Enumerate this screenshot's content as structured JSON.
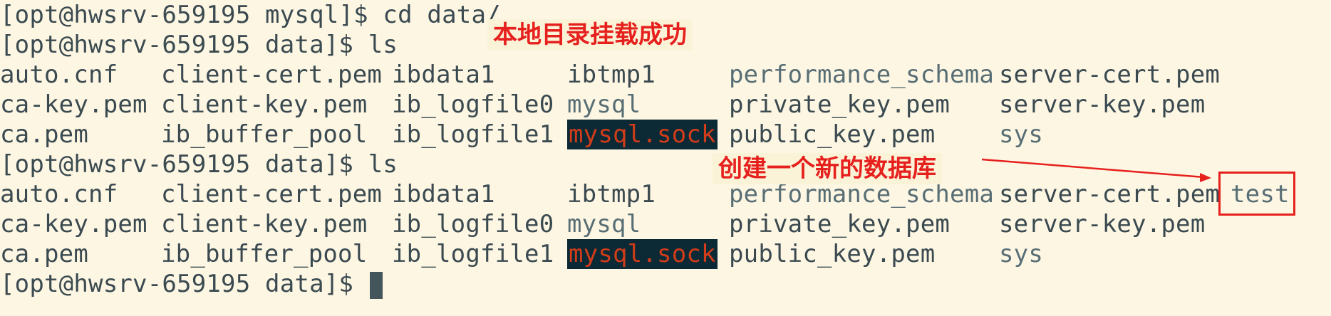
{
  "terminal": {
    "lines": [
      {
        "type": "prompt",
        "prompt": "[opt@hwsrv-659195 mysql]$ ",
        "command": "cd data/"
      },
      {
        "type": "prompt",
        "prompt": "[opt@hwsrv-659195 data]$ ",
        "command": "ls"
      },
      {
        "type": "files",
        "cols": [
          "auto.cnf",
          "client-cert.pem",
          "ibdata1",
          "ibtmp1",
          "performance_schema",
          "server-cert.pem"
        ]
      },
      {
        "type": "files",
        "cols": [
          "ca-key.pem",
          "client-key.pem",
          "ib_logfile0",
          "mysql",
          "private_key.pem",
          "server-key.pem"
        ]
      },
      {
        "type": "files",
        "cols": [
          "ca.pem",
          "ib_buffer_pool",
          "ib_logfile1",
          "mysql.sock",
          "public_key.pem",
          "sys"
        ]
      },
      {
        "type": "prompt",
        "prompt": "[opt@hwsrv-659195 data]$ ",
        "command": "ls"
      },
      {
        "type": "files",
        "cols": [
          "auto.cnf",
          "client-cert.pem",
          "ibdata1",
          "ibtmp1",
          "performance_schema",
          "server-cert.pem",
          "test"
        ]
      },
      {
        "type": "files",
        "cols": [
          "ca-key.pem",
          "client-key.pem",
          "ib_logfile0",
          "mysql",
          "private_key.pem",
          "server-key.pem"
        ]
      },
      {
        "type": "files",
        "cols": [
          "ca.pem",
          "ib_buffer_pool",
          "ib_logfile1",
          "mysql.sock",
          "public_key.pem",
          "sys"
        ]
      },
      {
        "type": "prompt",
        "prompt": "[opt@hwsrv-659195 data]$ ",
        "command": ""
      }
    ],
    "directories": [
      "performance_schema",
      "mysql",
      "sys",
      "test"
    ],
    "sockets": [
      "mysql.sock"
    ]
  },
  "annotations": {
    "mount_note": "本地目录挂载成功",
    "create_note": "创建一个新的数据库"
  },
  "colors": {
    "background": "#fdf6e3",
    "text": "#3a4a50",
    "directory": "#586e75",
    "socket_bg": "#0b2a35",
    "socket_fg": "#d23c1a",
    "annotation": "#e6201d"
  }
}
